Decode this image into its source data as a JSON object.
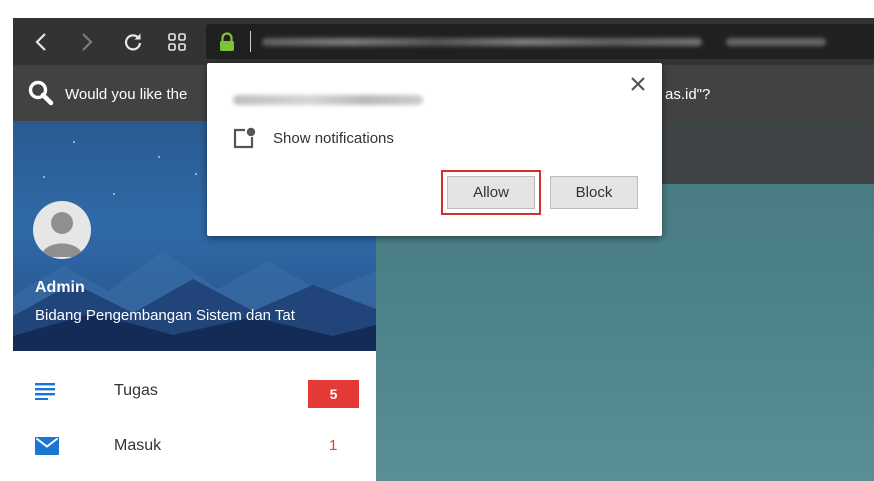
{
  "toolbar": {
    "back_icon": "chevron-left-icon",
    "forward_icon": "chevron-right-icon",
    "reload_icon": "reload-icon",
    "apps_icon": "apps-grid-icon",
    "lock_color": "#7cc33a"
  },
  "infobar": {
    "text_start": "Would you like the",
    "text_end": "as.id\"?"
  },
  "sidebar": {
    "user_name": "Admin",
    "user_unit": "Bidang Pengembangan Sistem dan Tat",
    "items": [
      {
        "label": "Tugas",
        "badge": "5"
      },
      {
        "label": "Masuk",
        "count": "1"
      }
    ]
  },
  "popup": {
    "permission_text": "Show notifications",
    "allow_label": "Allow",
    "block_label": "Block"
  },
  "colors": {
    "badge_red": "#e53935",
    "highlight_red": "#d32f2f",
    "menu_blue": "#1976d2"
  }
}
